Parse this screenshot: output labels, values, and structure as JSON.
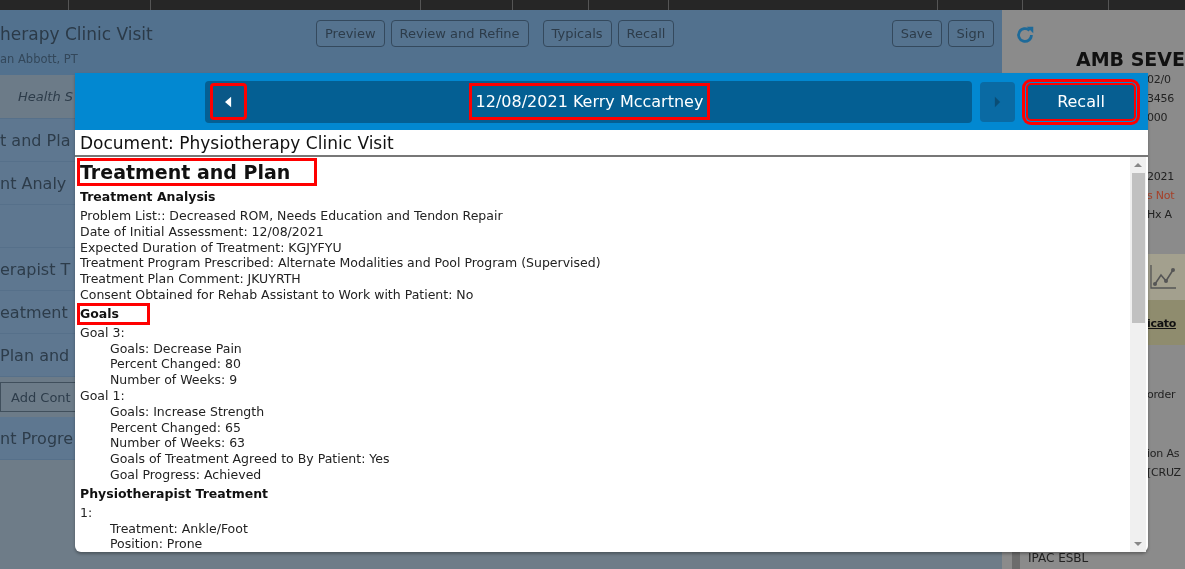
{
  "editor": {
    "title": "herapy Clinic Visit",
    "author": "an Abbott, PT",
    "buttons": [
      {
        "label": "Preview"
      },
      {
        "label": "Review and Refine"
      },
      {
        "label": "Typicals"
      },
      {
        "label": "Recall"
      }
    ],
    "right_buttons": [
      {
        "label": "Save"
      },
      {
        "label": "Sign"
      }
    ]
  },
  "sidebar": {
    "items": [
      {
        "label": "Health S",
        "kind": "filter"
      },
      {
        "label": "t and Pla",
        "kind": "section"
      },
      {
        "label": "nt Analy",
        "kind": "section"
      },
      {
        "kind": "blank"
      },
      {
        "label": "erapist T",
        "kind": "section"
      },
      {
        "label": "eatment",
        "kind": "section"
      },
      {
        "label": "Plan and",
        "kind": "section"
      },
      {
        "label": "Add Cont",
        "kind": "button"
      },
      {
        "label": "nt Progre",
        "kind": "section"
      }
    ]
  },
  "patient_panel": {
    "items": [
      {
        "kind": "name",
        "text": "AMB SEVE"
      },
      {
        "kind": "info",
        "text": "02/0"
      },
      {
        "kind": "info",
        "text": "3456"
      },
      {
        "kind": "info",
        "text": "000"
      },
      {
        "kind": "gap"
      },
      {
        "kind": "info",
        "text": "2021"
      },
      {
        "kind": "alert",
        "text": "s Not"
      },
      {
        "kind": "info",
        "text": "Hx A"
      },
      {
        "kind": "chart_icon"
      },
      {
        "kind": "link",
        "text": "icato"
      },
      {
        "kind": "gap"
      },
      {
        "kind": "info",
        "text": "order"
      },
      {
        "kind": "gap"
      },
      {
        "kind": "info",
        "text": "ion As"
      },
      {
        "kind": "info",
        "text": "[CRUZ"
      },
      {
        "kind": "tag",
        "text": "IPAC ESBL"
      }
    ]
  },
  "recall_dialog": {
    "prev_button": {
      "highlighted": true
    },
    "title": {
      "text": "12/08/2021 Kerry Mccartney",
      "highlighted": true
    },
    "next_button": {
      "highlighted": false
    },
    "recall_button": {
      "label": "Recall",
      "highlighted": true
    },
    "document_label": "Document: Physiotherapy Clinic Visit",
    "content": [
      {
        "kind": "title",
        "text": "Treatment and Plan",
        "highlighted": true
      },
      {
        "kind": "heading",
        "text": "Treatment Analysis",
        "highlighted": false
      },
      {
        "kind": "line",
        "text": "Problem List:: Decreased ROM, Needs Education and Tendon Repair"
      },
      {
        "kind": "line",
        "text": "Date of Initial Assessment: 12/08/2021"
      },
      {
        "kind": "line",
        "text": "Expected Duration of Treatment: KGJYFYU"
      },
      {
        "kind": "line",
        "text": "Treatment Program Prescribed: Alternate Modalities and Pool Program (Supervised)"
      },
      {
        "kind": "line",
        "text": "Treatment Plan Comment: JKUYRTH"
      },
      {
        "kind": "line",
        "text": "Consent Obtained for Rehab Assistant to Work with Patient: No"
      },
      {
        "kind": "heading",
        "text": "Goals",
        "highlighted": true
      },
      {
        "kind": "line",
        "text": "Goal 3:",
        "children": [
          {
            "text": "Goals: Decrease Pain"
          },
          {
            "text": "Percent Changed: 80"
          },
          {
            "text": "Number of Weeks: 9"
          }
        ]
      },
      {
        "kind": "line",
        "text": "Goal 1:",
        "children": [
          {
            "text": "Goals: Increase Strength"
          },
          {
            "text": "Percent Changed: 65"
          },
          {
            "text": "Number of Weeks: 63"
          },
          {
            "text": "Goals of Treatment Agreed to By Patient: Yes"
          },
          {
            "text": "Goal Progress: Achieved"
          }
        ]
      },
      {
        "kind": "heading",
        "text": "Physiotherapist Treatment",
        "highlighted": false
      },
      {
        "kind": "line",
        "text": "1:",
        "children": [
          {
            "text": "Treatment: Ankle/Foot"
          },
          {
            "text": "Position: Prone"
          }
        ]
      }
    ]
  }
}
